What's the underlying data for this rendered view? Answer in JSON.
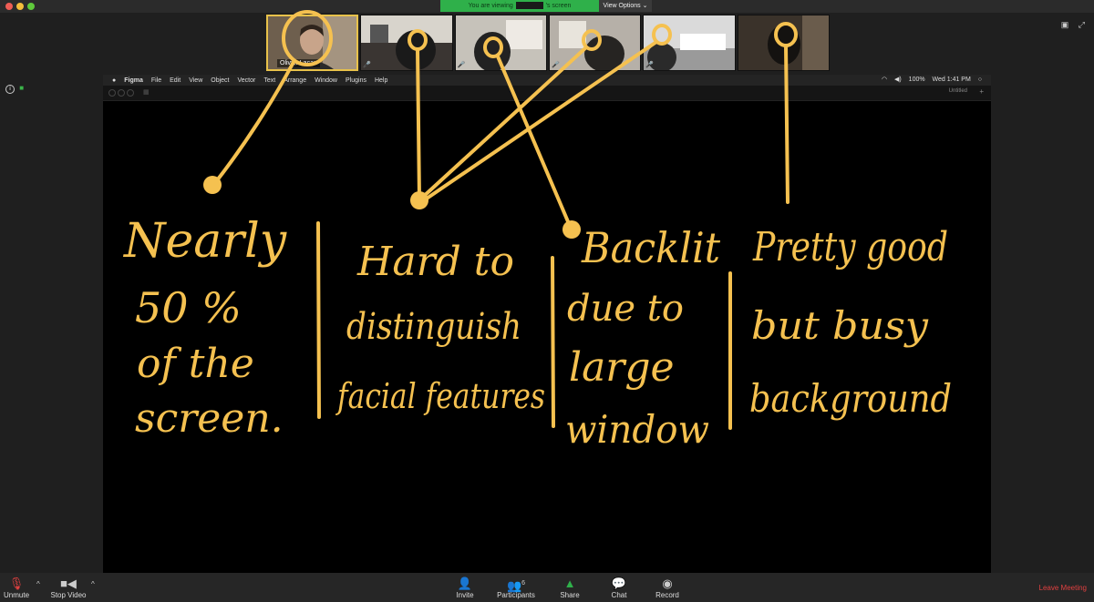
{
  "top": {
    "viewing_prefix": "You are viewing",
    "viewing_suffix": "'s screen",
    "view_options": "View Options ⌄"
  },
  "thumbnails": [
    {
      "name": "Olivier Lacan",
      "bg": "#8a7a66",
      "active": true
    },
    {
      "name": "",
      "bg": "#5a5550",
      "active": false
    },
    {
      "name": "",
      "bg": "#6b6660",
      "active": false
    },
    {
      "name": "",
      "bg": "#4a4744",
      "active": false
    },
    {
      "name": "",
      "bg": "#8c8c8c",
      "active": false
    },
    {
      "name": "",
      "bg": "#3c342c",
      "active": false
    }
  ],
  "mac": {
    "apple": "",
    "app": "Figma",
    "menus": [
      "File",
      "Edit",
      "View",
      "Object",
      "Vector",
      "Text",
      "Arrange",
      "Window",
      "Plugins",
      "Help"
    ],
    "battery": "100%",
    "clock": "Wed 1:41 PM",
    "doc_tab": "Untitled"
  },
  "annotations": {
    "col1": [
      "Nearly",
      "50 %",
      "of the",
      "screen."
    ],
    "col2": [
      "Hard to",
      "distinguish",
      "facial features"
    ],
    "col3": [
      "Backlit",
      "due to",
      "large",
      "window"
    ],
    "col4": [
      "Pretty good",
      "but busy",
      "background"
    ]
  },
  "bottom": {
    "unmute": "Unmute",
    "stop_video": "Stop Video",
    "invite": "Invite",
    "participants": "Participants",
    "participants_count": "6",
    "share": "Share",
    "chat": "Chat",
    "record": "Record",
    "leave": "Leave Meeting"
  },
  "colors": {
    "ink": "#f5c150",
    "share_green": "#2fb04a",
    "leave_red": "#e04040"
  }
}
